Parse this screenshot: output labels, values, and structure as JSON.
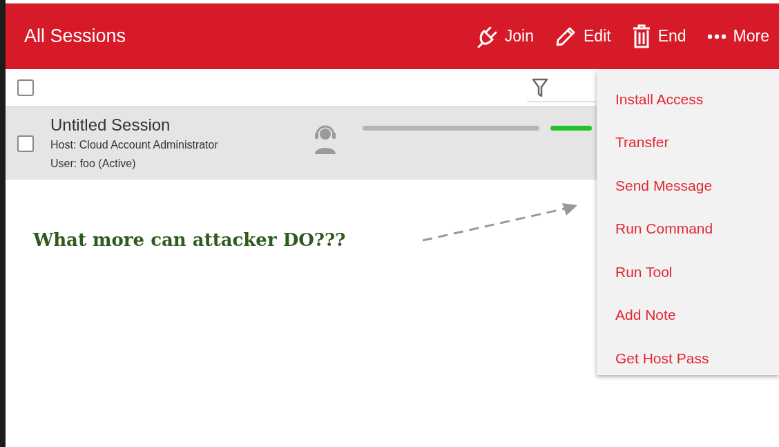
{
  "header": {
    "title": "All Sessions",
    "actions": [
      {
        "label": "Join",
        "kind": "plug"
      },
      {
        "label": "Edit",
        "kind": "pencil"
      },
      {
        "label": "End",
        "kind": "trash"
      },
      {
        "label": "More",
        "kind": "dots"
      }
    ]
  },
  "select_all": {
    "checked": false
  },
  "sessions": [
    {
      "title": "Untitled Session",
      "host": "Host: Cloud Account Administrator",
      "user": "User: foo (Active)",
      "checked": false
    }
  ],
  "more_menu": {
    "items": [
      "Install Access",
      "Transfer",
      "Send Message",
      "Run Command",
      "Run Tool",
      "Add Note",
      "Get Host Pass"
    ]
  },
  "annotation": {
    "text": "What more can attacker DO???"
  }
}
